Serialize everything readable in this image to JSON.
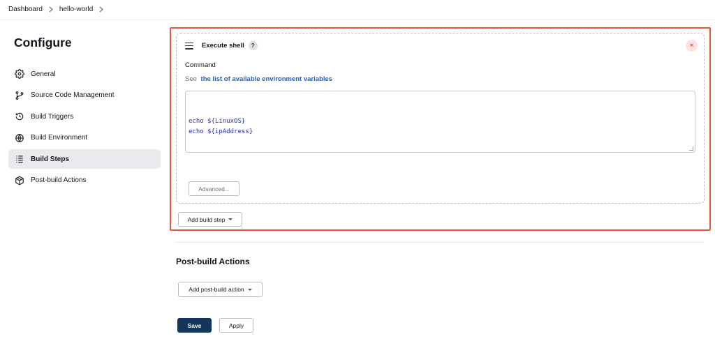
{
  "breadcrumb": {
    "items": [
      "Dashboard",
      "hello-world"
    ]
  },
  "page": {
    "title": "Configure"
  },
  "sidebar": {
    "items": [
      {
        "label": "General",
        "icon": "gear-icon",
        "active": false
      },
      {
        "label": "Source Code Management",
        "icon": "branch-icon",
        "active": false
      },
      {
        "label": "Build Triggers",
        "icon": "clock-icon",
        "active": false
      },
      {
        "label": "Build Environment",
        "icon": "globe-icon",
        "active": false
      },
      {
        "label": "Build Steps",
        "icon": "list-icon",
        "active": true
      },
      {
        "label": "Post-build Actions",
        "icon": "package-icon",
        "active": false
      }
    ]
  },
  "build_step": {
    "title": "Execute shell",
    "help": "?",
    "close_glyph": "×",
    "command_label": "Command",
    "see_prefix": "See",
    "see_link": "the list of available environment variables",
    "command_value": "echo ${LinuxOS}\necho ${ipAddress}",
    "advanced_label": "Advanced..."
  },
  "add_build_step_label": "Add build step",
  "post_build": {
    "title": "Post-build Actions",
    "add_label": "Add post-build action"
  },
  "actions": {
    "save_label": "Save",
    "apply_label": "Apply"
  },
  "colors": {
    "highlight_border": "#e8573f",
    "save_bg": "#13365a",
    "link": "#1f5fc8",
    "code": "#2a2ab0"
  }
}
